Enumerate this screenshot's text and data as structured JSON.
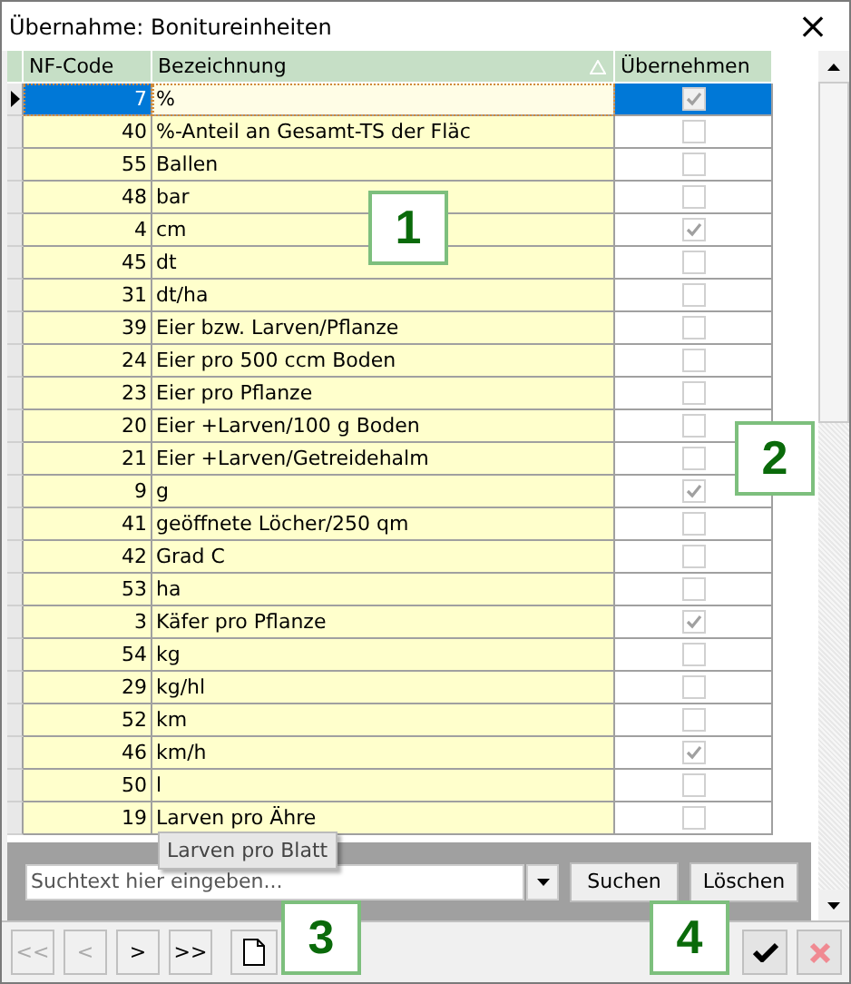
{
  "window": {
    "title": "Übernahme: Bonitureinheiten",
    "close": "×"
  },
  "table": {
    "columns": [
      {
        "label": "NF-Code",
        "sorted": false
      },
      {
        "label": "Bezeichnung",
        "sorted": true
      },
      {
        "label": "Übernehmen",
        "sorted": false
      }
    ],
    "rows": [
      {
        "code": "7",
        "name": "%",
        "checked": true,
        "selected": true
      },
      {
        "code": "40",
        "name": "%-Anteil an Gesamt-TS der Fläc",
        "checked": false,
        "selected": false
      },
      {
        "code": "55",
        "name": "Ballen",
        "checked": false,
        "selected": false
      },
      {
        "code": "48",
        "name": "bar",
        "checked": false,
        "selected": false
      },
      {
        "code": "4",
        "name": "cm",
        "checked": true,
        "selected": false
      },
      {
        "code": "45",
        "name": "dt",
        "checked": false,
        "selected": false
      },
      {
        "code": "31",
        "name": "dt/ha",
        "checked": false,
        "selected": false
      },
      {
        "code": "39",
        "name": "Eier bzw. Larven/Pflanze",
        "checked": false,
        "selected": false
      },
      {
        "code": "24",
        "name": "Eier pro 500 ccm Boden",
        "checked": false,
        "selected": false
      },
      {
        "code": "23",
        "name": "Eier pro Pflanze",
        "checked": false,
        "selected": false
      },
      {
        "code": "20",
        "name": "Eier +Larven/100 g Boden",
        "checked": false,
        "selected": false
      },
      {
        "code": "21",
        "name": "Eier +Larven/Getreidehalm",
        "checked": false,
        "selected": false
      },
      {
        "code": "9",
        "name": "g",
        "checked": true,
        "selected": false
      },
      {
        "code": "41",
        "name": "geöffnete Löcher/250 qm",
        "checked": false,
        "selected": false
      },
      {
        "code": "42",
        "name": "Grad C",
        "checked": false,
        "selected": false
      },
      {
        "code": "53",
        "name": "ha",
        "checked": false,
        "selected": false
      },
      {
        "code": "3",
        "name": "Käfer pro Pflanze",
        "checked": true,
        "selected": false
      },
      {
        "code": "54",
        "name": "kg",
        "checked": false,
        "selected": false
      },
      {
        "code": "29",
        "name": "kg/hl",
        "checked": false,
        "selected": false
      },
      {
        "code": "52",
        "name": "km",
        "checked": false,
        "selected": false
      },
      {
        "code": "46",
        "name": "km/h",
        "checked": true,
        "selected": false
      },
      {
        "code": "50",
        "name": "l",
        "checked": false,
        "selected": false
      },
      {
        "code": "19",
        "name": "Larven pro Ähre",
        "checked": false,
        "selected": false
      }
    ]
  },
  "tooltip": "Larven pro Blatt",
  "search": {
    "placeholder": "Suchtext hier eingeben...",
    "buttons": [
      "Suchen",
      "Löschen"
    ]
  },
  "toolbar": {
    "nav_buttons": [
      {
        "label": "<<",
        "disabled": true
      },
      {
        "label": "<",
        "disabled": true
      },
      {
        "label": ">",
        "disabled": false
      },
      {
        "label": ">>",
        "disabled": false
      }
    ]
  },
  "callouts": [
    "1",
    "2",
    "3",
    "4"
  ]
}
